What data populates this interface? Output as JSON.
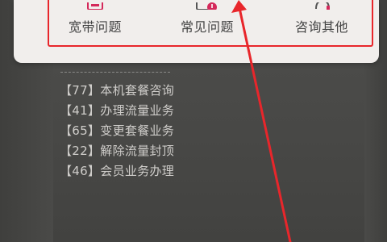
{
  "quick_actions": [
    {
      "label": "宽带问题",
      "icon": "broadband-icon"
    },
    {
      "label": "常见问题",
      "icon": "faq-icon"
    },
    {
      "label": "咨询其他",
      "icon": "consult-icon"
    }
  ],
  "sms_menu": [
    {
      "code": "【77】",
      "text": "本机套餐咨询"
    },
    {
      "code": "【41】",
      "text": "办理流量业务"
    },
    {
      "code": "【65】",
      "text": "变更套餐业务"
    },
    {
      "code": "【22】",
      "text": "解除流量封顶"
    },
    {
      "code": "【46】",
      "text": "会员业务办理"
    }
  ],
  "colors": {
    "annotation_red": "#e8262b",
    "popup_bg": "#f1eeec",
    "overlay_bg": "#4a4a48",
    "brand_icon": "#d4285a"
  }
}
